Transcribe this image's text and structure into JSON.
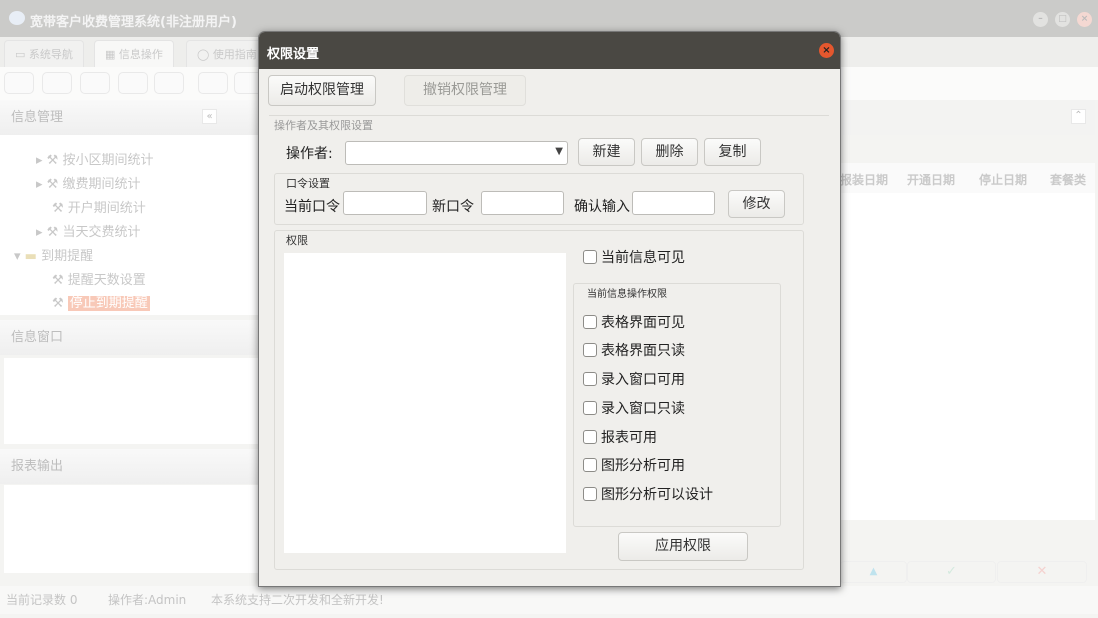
{
  "window": {
    "title": "宽带客户收费管理系统(非注册用户)",
    "logo_icon": "yf-logo-icon",
    "controls": [
      "minimize",
      "maximize",
      "close"
    ]
  },
  "tabs": [
    {
      "label": "系统导航",
      "icon": "monitor-icon"
    },
    {
      "label": "信息操作",
      "icon": "grid-icon"
    },
    {
      "label": "使用指南",
      "icon": "clock-icon"
    }
  ],
  "left": {
    "panel1_title": "信息管理",
    "tree": [
      {
        "label": "按小区期间统计",
        "expandable": true
      },
      {
        "label": "缴费期间统计",
        "expandable": true
      },
      {
        "label": "开户期间统计",
        "expandable": false
      },
      {
        "label": "当天交费统计",
        "expandable": true
      },
      {
        "label": "到期提醒",
        "folder": true
      },
      {
        "label": "提醒天数设置"
      },
      {
        "label": "停止到期提醒",
        "selected": true
      }
    ],
    "panel2_title": "信息窗口",
    "panel3_title": "报表输出"
  },
  "table": {
    "columns": [
      "报装日期",
      "开通日期",
      "停止日期",
      "套餐类"
    ]
  },
  "status": {
    "records": "当前记录数 0",
    "operator": "操作者:Admin",
    "note": "本系统支持二次开发和全新开发!"
  },
  "dialog": {
    "title": "权限设置",
    "tab_enable": "启动权限管理",
    "tab_revoke": "撤销权限管理",
    "group_operator": "操作者及其权限设置",
    "operator_label": "操作者:",
    "operator_value": "",
    "btn_new": "新建",
    "btn_delete": "删除",
    "btn_copy": "复制",
    "group_password": "口令设置",
    "cur_pw": "当前口令",
    "new_pw": "新口令",
    "confirm_pw": "确认输入",
    "btn_modify": "修改",
    "group_perm": "权限",
    "cb_visible": "当前信息可见",
    "group_ops": "当前信息操作权限",
    "ops": [
      "表格界面可见",
      "表格界面只读",
      "录入窗口可用",
      "录入窗口只读",
      "报表可用",
      "图形分析可用",
      "图形分析可以设计"
    ],
    "btn_apply": "应用权限"
  },
  "colors": {
    "dialog_title_bg": "#4a4843",
    "close_button": "#e4572e",
    "selected_item": "#f8c9b8"
  }
}
